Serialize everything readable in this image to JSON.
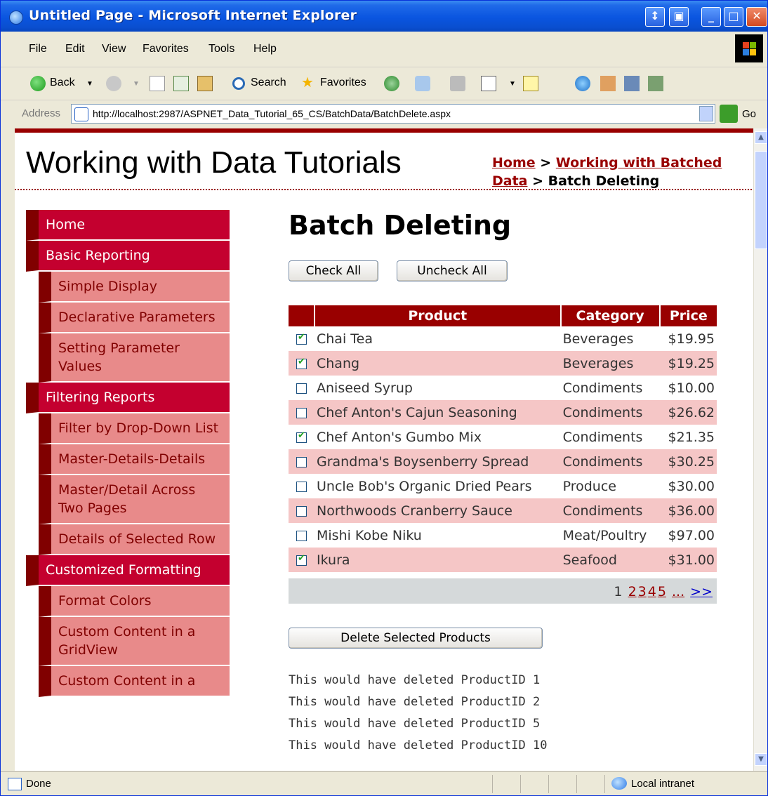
{
  "window": {
    "title": "Untitled Page - Microsoft Internet Explorer"
  },
  "menu": {
    "items": [
      "File",
      "Edit",
      "View",
      "Favorites",
      "Tools",
      "Help"
    ]
  },
  "toolbar": {
    "back_label": "Back",
    "search_label": "Search",
    "favorites_label": "Favorites"
  },
  "address": {
    "label": "Address",
    "url": "http://localhost:2987/ASPNET_Data_Tutorial_65_CS/BatchData/BatchDelete.aspx",
    "go_label": "Go"
  },
  "page": {
    "site_title": "Working with Data Tutorials",
    "breadcrumb": {
      "home": "Home",
      "sep1": " > ",
      "section": "Working with Batched Data",
      "sep2": " > ",
      "current": "Batch Deleting"
    },
    "heading": "Batch Deleting",
    "check_all": "Check All",
    "uncheck_all": "Uncheck All",
    "delete_button": "Delete Selected Products"
  },
  "sidebar": {
    "groups": [
      {
        "label": "Home",
        "items": []
      },
      {
        "label": "Basic Reporting",
        "items": [
          "Simple Display",
          "Declarative Parameters",
          "Setting Parameter Values"
        ]
      },
      {
        "label": "Filtering Reports",
        "items": [
          "Filter by Drop-Down List",
          "Master-Details-Details",
          "Master/Detail Across Two Pages",
          "Details of Selected Row"
        ]
      },
      {
        "label": "Customized Formatting",
        "items": [
          "Format Colors",
          "Custom Content in a GridView",
          "Custom Content in a"
        ]
      }
    ]
  },
  "grid": {
    "columns": [
      "",
      "Product",
      "Category",
      "Price"
    ],
    "rows": [
      {
        "checked": true,
        "product": "Chai Tea",
        "category": "Beverages",
        "price": "$19.95"
      },
      {
        "checked": true,
        "product": "Chang",
        "category": "Beverages",
        "price": "$19.25"
      },
      {
        "checked": false,
        "product": "Aniseed Syrup",
        "category": "Condiments",
        "price": "$10.00"
      },
      {
        "checked": false,
        "product": "Chef Anton's Cajun Seasoning",
        "category": "Condiments",
        "price": "$26.62"
      },
      {
        "checked": true,
        "product": "Chef Anton's Gumbo Mix",
        "category": "Condiments",
        "price": "$21.35"
      },
      {
        "checked": false,
        "product": "Grandma's Boysenberry Spread",
        "category": "Condiments",
        "price": "$30.25"
      },
      {
        "checked": false,
        "product": "Uncle Bob's Organic Dried Pears",
        "category": "Produce",
        "price": "$30.00"
      },
      {
        "checked": false,
        "product": "Northwoods Cranberry Sauce",
        "category": "Condiments",
        "price": "$36.00"
      },
      {
        "checked": false,
        "product": "Mishi Kobe Niku",
        "category": "Meat/Poultry",
        "price": "$97.00"
      },
      {
        "checked": true,
        "product": "Ikura",
        "category": "Seafood",
        "price": "$31.00"
      }
    ],
    "pager": {
      "current": "1",
      "pages": [
        "2",
        "3",
        "4",
        "5",
        "..."
      ],
      "next": ">>"
    }
  },
  "messages": [
    "This would have deleted ProductID 1",
    "This would have deleted ProductID 2",
    "This would have deleted ProductID 5",
    "This would have deleted ProductID 10"
  ],
  "status": {
    "text": "Done",
    "zone": "Local intranet"
  },
  "colors": {
    "accent": "#990000",
    "category_bg": "#c4002f",
    "item_bg": "#e88a8a",
    "alt_row": "#f5c6c6"
  }
}
